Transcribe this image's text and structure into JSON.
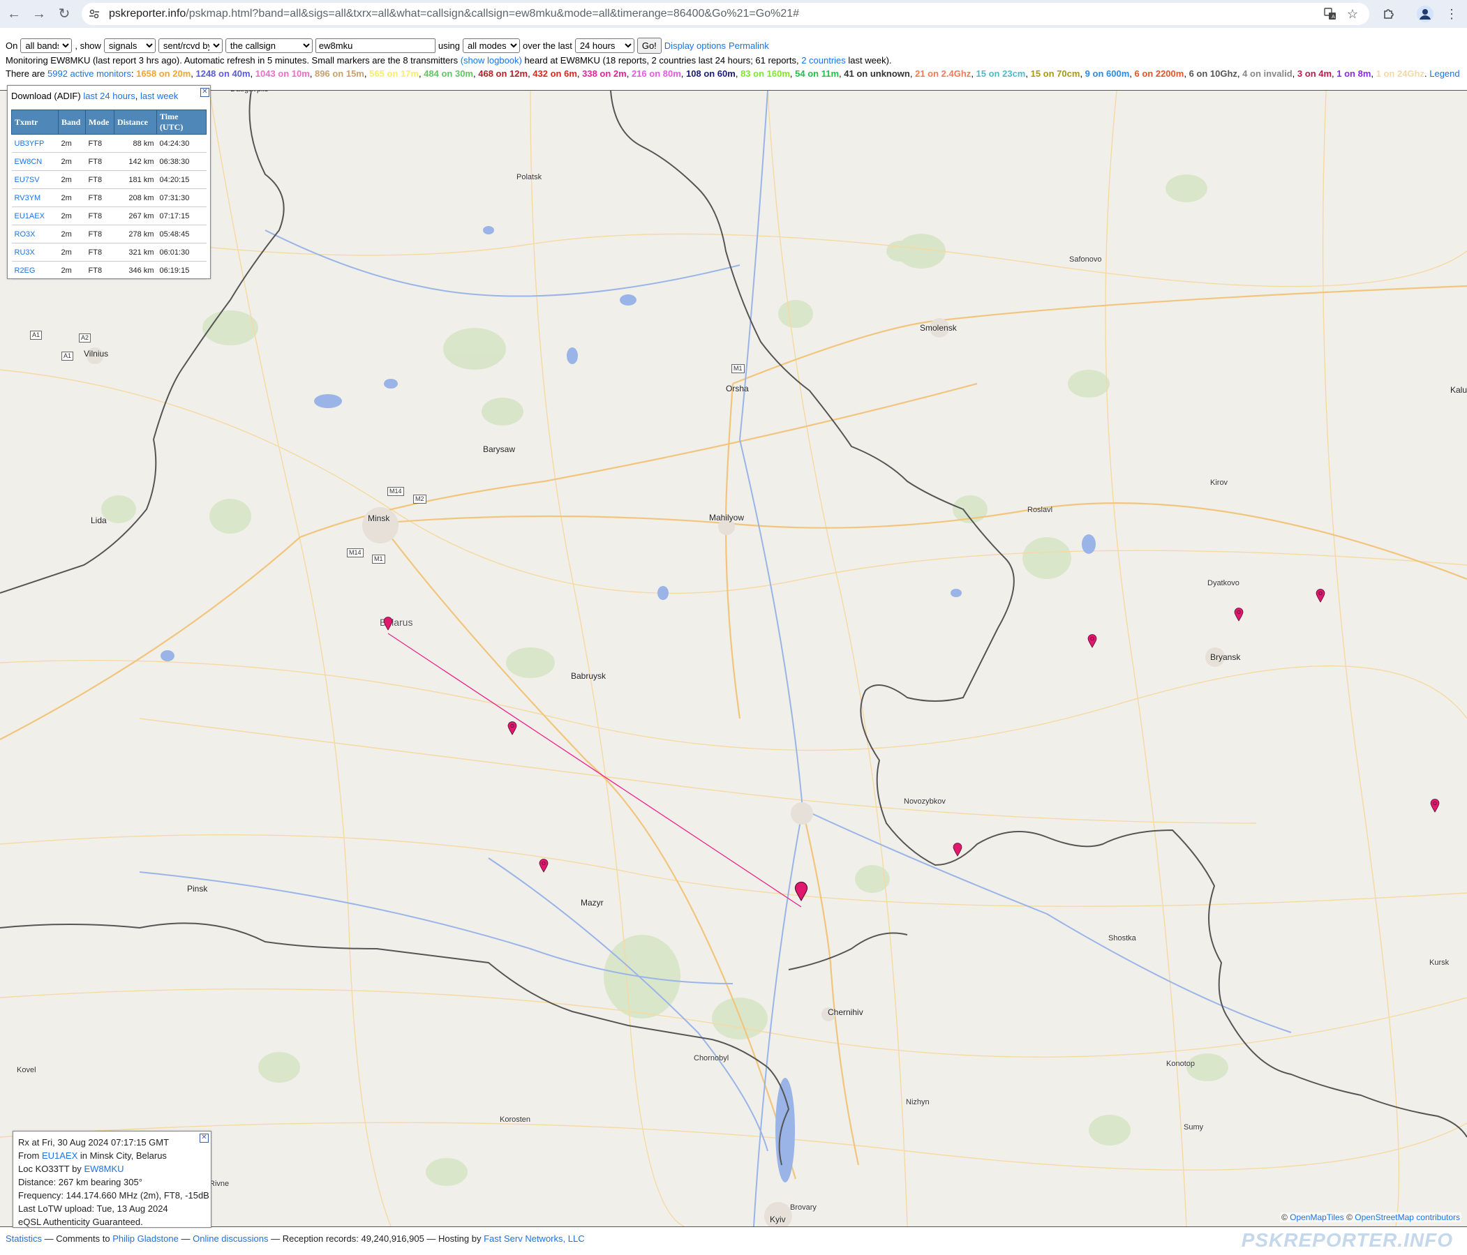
{
  "browser": {
    "url_host": "pskreporter.info",
    "url_path": "/pskmap.html?band=all&sigs=all&txrx=all&what=callsign&callsign=ew8mku&mode=all&timerange=86400&Go%21=Go%21#"
  },
  "controls": {
    "on_label": "On",
    "band": "all bands",
    "show_label": ", show",
    "show": "signals",
    "direction": "sent/rcvd by",
    "what": "the callsign",
    "callsign": "ew8mku",
    "using_label": "using",
    "mode": "all modes",
    "over_label": "over the last",
    "timerange": "24 hours",
    "go_label": "Go!",
    "display_options": "Display options",
    "permalink": "Permalink"
  },
  "status": {
    "monitoring": "Monitoring EW8MKU (last report 3 hrs ago). Automatic refresh in 5 minutes. Small markers are the 8 transmitters",
    "show_logbook": "(show logbook)",
    "heard_text": "heard at EW8MKU (18 reports, 2 countries last 24 hours; 61 reports,",
    "countries_link": "2 countries",
    "last_week": "last week)."
  },
  "monitors": {
    "prefix": "There are",
    "active_link": "5992 active monitors",
    "colon": ":",
    "bands": [
      {
        "text": "1658 on 20m",
        "color": "#f2a531"
      },
      {
        "text": "1248 on 40m",
        "color": "#5a5adb"
      },
      {
        "text": "1043 on 10m",
        "color": "#ea6fc4"
      },
      {
        "text": "896 on 15m",
        "color": "#c8a070"
      },
      {
        "text": "565 on 17m",
        "color": "#f4ee6c"
      },
      {
        "text": "484 on 30m",
        "color": "#62c462"
      },
      {
        "text": "468 on 12m",
        "color": "#b2232a"
      },
      {
        "text": "432 on 6m",
        "color": "#e42222"
      },
      {
        "text": "338 on 2m",
        "color": "#ea1f9a"
      },
      {
        "text": "216 on 80m",
        "color": "#e25be2"
      },
      {
        "text": "108 on 60m",
        "color": "#1a1a78"
      },
      {
        "text": "83 on 160m",
        "color": "#7ee82a"
      },
      {
        "text": "54 on 11m",
        "color": "#22c04a"
      },
      {
        "text": "41 on unknown",
        "color": "#333333"
      },
      {
        "text": "21 on 2.4Ghz",
        "color": "#f07a56"
      },
      {
        "text": "15 on 23cm",
        "color": "#52b8c8"
      },
      {
        "text": "15 on 70cm",
        "color": "#a89a10"
      },
      {
        "text": "9 on 600m",
        "color": "#2a8ae8"
      },
      {
        "text": "6 on 2200m",
        "color": "#e2552a"
      },
      {
        "text": "6 on 10Ghz",
        "color": "#555555"
      },
      {
        "text": "4 on invalid",
        "color": "#888888"
      },
      {
        "text": "3 on 4m",
        "color": "#c0184a"
      },
      {
        "text": "1 on 8m",
        "color": "#8a2ae0"
      },
      {
        "text": "1 on 24Ghz",
        "color": "#f2d8a8"
      }
    ],
    "legend": "Legend"
  },
  "download_panel": {
    "title": "Download (ADIF)",
    "last24": "last 24 hours",
    "lastweek": "last week",
    "headers": [
      "Txmtr",
      "Band",
      "Mode",
      "Distance",
      "Time (UTC)"
    ],
    "rows": [
      {
        "call": "UB3YFP",
        "band": "2m",
        "mode": "FT8",
        "distance": "88 km",
        "time": "04:24:30"
      },
      {
        "call": "EW8CN",
        "band": "2m",
        "mode": "FT8",
        "distance": "142 km",
        "time": "06:38:30"
      },
      {
        "call": "EU7SV",
        "band": "2m",
        "mode": "FT8",
        "distance": "181 km",
        "time": "04:20:15"
      },
      {
        "call": "RV3YM",
        "band": "2m",
        "mode": "FT8",
        "distance": "208 km",
        "time": "07:31:30"
      },
      {
        "call": "EU1AEX",
        "band": "2m",
        "mode": "FT8",
        "distance": "267 km",
        "time": "07:17:15"
      },
      {
        "call": "RO3X",
        "band": "2m",
        "mode": "FT8",
        "distance": "278 km",
        "time": "05:48:45"
      },
      {
        "call": "RU3X",
        "band": "2m",
        "mode": "FT8",
        "distance": "321 km",
        "time": "06:01:30"
      },
      {
        "call": "R2EG",
        "band": "2m",
        "mode": "FT8",
        "distance": "346 km",
        "time": "06:19:15"
      }
    ]
  },
  "info_panel": {
    "rx": "Rx at Fri, 30 Aug 2024 07:17:15 GMT",
    "from_prefix": "From",
    "from_call": "EU1AEX",
    "from_suffix": "in Minsk City, Belarus",
    "loc_prefix": "Loc KO33TT by",
    "loc_call": "EW8MKU",
    "distance": "Distance: 267 km bearing 305°",
    "frequency": "Frequency: 144.174.660 MHz (2m), FT8, -15dB",
    "lotw": "Last LoTW upload: Tue, 13 Aug 2024",
    "eqsl": "eQSL Authenticity Guaranteed."
  },
  "map": {
    "cities": [
      "Daugavpils",
      "Polatsk",
      "Safonovo",
      "Smolensk",
      "Vilnius",
      "Orsha",
      "Kalu",
      "Barysaw",
      "Kirov",
      "Minsk",
      "Lida",
      "Mahilyow",
      "Roslavl",
      "Dyatkovo",
      "Belarus",
      "Bryansk",
      "Babruysk",
      "Novozybkov",
      "Pinsk",
      "Mazyr",
      "Shostka",
      "Kursk",
      "Chernihiv",
      "Kovel",
      "Chornobyl",
      "Konotop",
      "Nizhyn",
      "Korosten",
      "Sumy",
      "Brovary",
      "Kyiv",
      "Rivne"
    ],
    "shields": [
      "A1",
      "A2",
      "A1",
      "M1",
      "M14",
      "M2",
      "M14",
      "M1"
    ],
    "attribution_copy": "©",
    "attribution_omt": "OpenMapTiles",
    "attribution_osm": "OpenStreetMap contributors"
  },
  "footer": {
    "statistics": "Statistics",
    "comments": "— Comments to",
    "author": "Philip Gladstone",
    "sep1": "—",
    "discussions": "Online discussions",
    "records": "— Reception records: 49,240,916,905 — Hosting by",
    "host": "Fast Serv Networks, LLC"
  },
  "logo": "PSKREPORTER.INFO"
}
